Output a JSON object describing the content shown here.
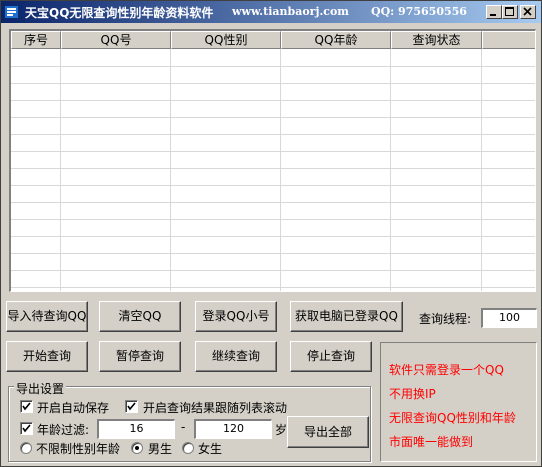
{
  "window": {
    "title": "天宝QQ无限查询性别年龄资料软件",
    "site": "www.tianbaorj.com",
    "qq_label": "QQ: 975650556",
    "controls": [
      "minimize",
      "maximize",
      "close"
    ]
  },
  "list": {
    "columns": [
      "序号",
      "QQ号",
      "QQ性别",
      "QQ年龄",
      "查询状态"
    ],
    "rows": []
  },
  "buttons": {
    "import": "导入待查询QQ",
    "clear": "清空QQ",
    "login": "登录QQ小号",
    "fetch_logged": "获取电脑已登录QQ",
    "start": "开始查询",
    "pause": "暂停查询",
    "resume": "继续查询",
    "stop": "停止查询",
    "export_all": "导出全部"
  },
  "threads": {
    "label": "查询线程:",
    "value": "100"
  },
  "export_settings": {
    "legend": "导出设置",
    "auto_save": {
      "label": "开启自动保存",
      "checked": true
    },
    "follow_scroll": {
      "label": "开启查询结果跟随列表滚动",
      "checked": true
    },
    "age_filter": {
      "label": "年龄过滤:",
      "checked": true,
      "min": "16",
      "dash": "-",
      "max": "120",
      "unit": "岁"
    },
    "gender": {
      "options": [
        {
          "label": "不限制性别年龄",
          "selected": false
        },
        {
          "label": "男生",
          "selected": true
        },
        {
          "label": "女生",
          "selected": false
        }
      ]
    }
  },
  "promo": {
    "lines": [
      "软件只需登录一个QQ",
      "不用换IP",
      "无限查询QQ性别和年龄",
      "市面唯一能做到"
    ],
    "color": "#ff0000"
  }
}
